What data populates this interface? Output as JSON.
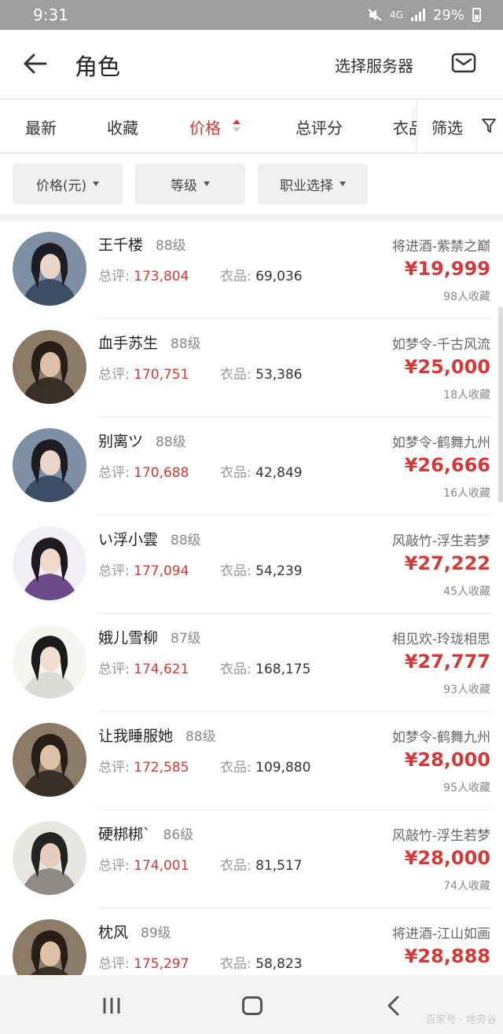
{
  "status": {
    "time": "9:31",
    "network": "4G",
    "battery": "29%"
  },
  "header": {
    "title": "角色",
    "server_button": "选择服务器"
  },
  "tabs": [
    {
      "label": "最新"
    },
    {
      "label": "收藏"
    },
    {
      "label": "价格"
    },
    {
      "label": "总评分"
    },
    {
      "label": "衣品"
    }
  ],
  "filter_label": "筛选",
  "dropdowns": [
    {
      "label": "价格(元)"
    },
    {
      "label": "等级"
    },
    {
      "label": "职业选择"
    }
  ],
  "labels": {
    "score": "总评:",
    "outfit": "衣品:"
  },
  "listings": [
    {
      "name": "王千楼",
      "level": "88级",
      "score": "173,804",
      "outfit": "69,036",
      "server": "将进酒-紫禁之巅",
      "price": "¥19,999",
      "favorites": "98人收藏",
      "avatar": "male-blue"
    },
    {
      "name": "血手苏生",
      "level": "88级",
      "score": "170,751",
      "outfit": "53,386",
      "server": "如梦令-千古风流",
      "price": "¥25,000",
      "favorites": "18人收藏",
      "avatar": "male-armor"
    },
    {
      "name": "别离ツ",
      "level": "88级",
      "score": "170,688",
      "outfit": "42,849",
      "server": "如梦令-鹤舞九州",
      "price": "¥26,666",
      "favorites": "16人收藏",
      "avatar": "male-blue"
    },
    {
      "name": "い浮小雲",
      "level": "88级",
      "score": "177,094",
      "outfit": "54,239",
      "server": "风敲竹-浮生若梦",
      "price": "¥27,222",
      "favorites": "45人收藏",
      "avatar": "female-purple"
    },
    {
      "name": "娥儿雪柳",
      "level": "87级",
      "score": "174,621",
      "outfit": "168,175",
      "server": "相见欢-玲珑相思",
      "price": "¥27,777",
      "favorites": "93人收藏",
      "avatar": "female-white"
    },
    {
      "name": "让我睡服她",
      "level": "88级",
      "score": "172,585",
      "outfit": "109,880",
      "server": "如梦令-鹤舞九州",
      "price": "¥28,000",
      "favorites": "95人收藏",
      "avatar": "male-armor"
    },
    {
      "name": "硬梆梆`",
      "level": "86级",
      "score": "174,001",
      "outfit": "81,517",
      "server": "风敲竹-浮生若梦",
      "price": "¥28,000",
      "favorites": "74人收藏",
      "avatar": "male-fur"
    },
    {
      "name": "枕风",
      "level": "89级",
      "score": "175,297",
      "outfit": "58,823",
      "server": "将进酒-江山如画",
      "price": "¥28,888",
      "favorites": "",
      "avatar": "male-armor"
    }
  ],
  "watermark": "百家号 · 地旁谷",
  "colors": {
    "accent": "#d23a3a",
    "status_bar": "#9e9e9e"
  }
}
